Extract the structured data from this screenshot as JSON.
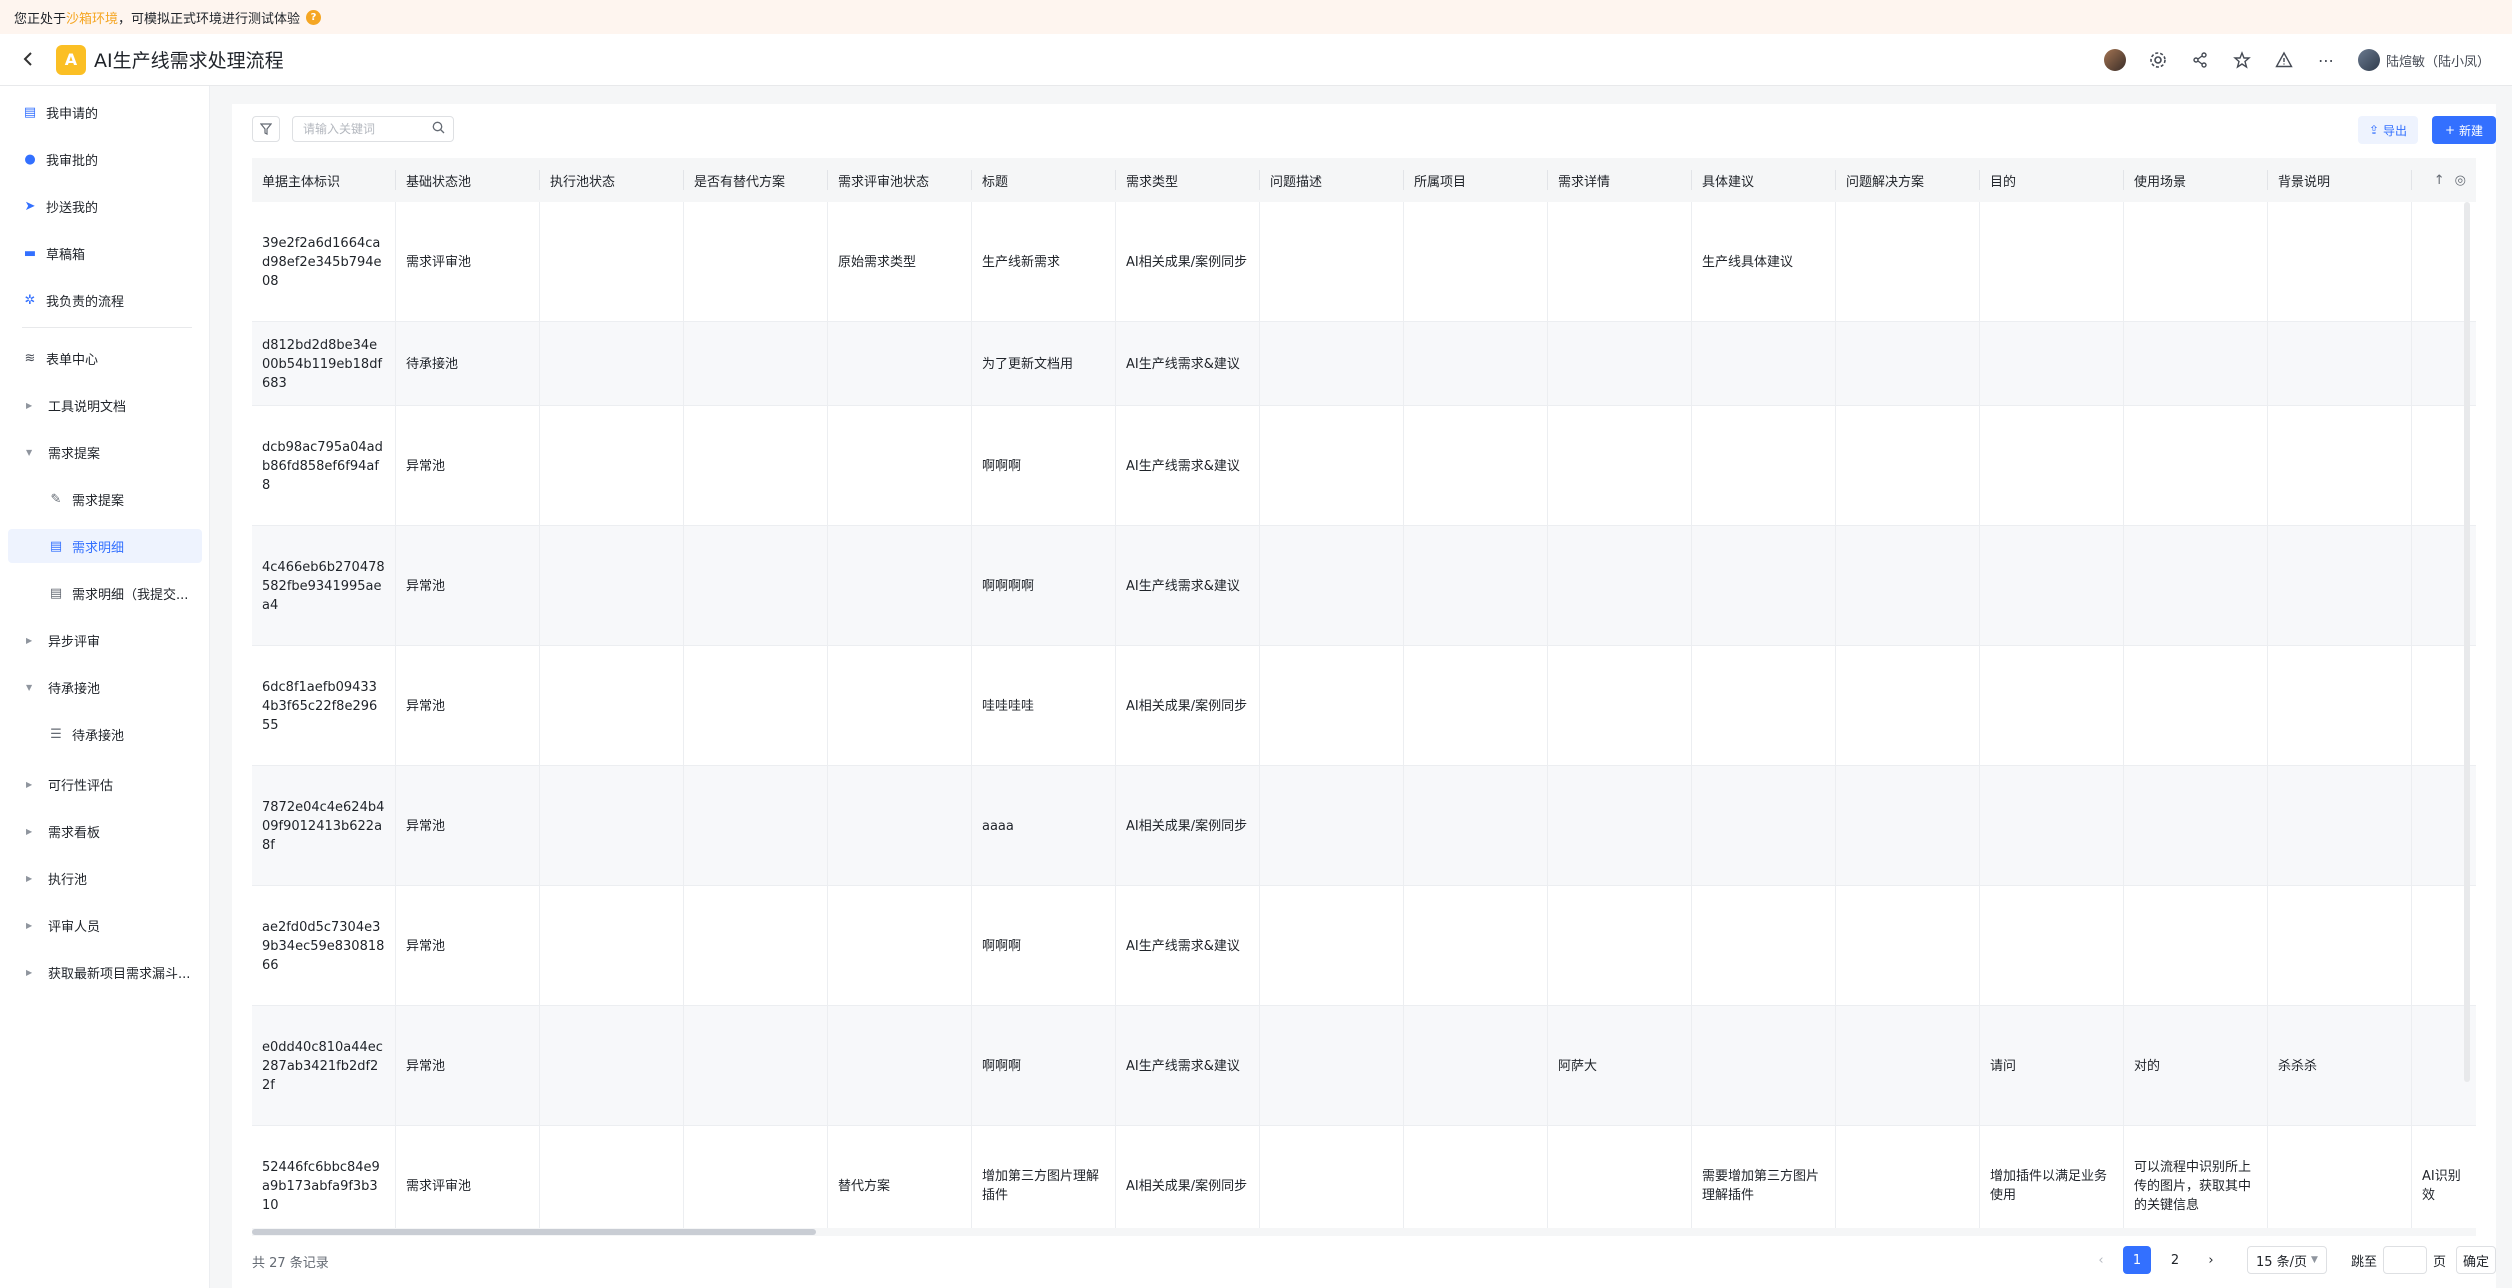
{
  "banner": {
    "prefix": "您正处于",
    "highlight": "沙箱环境",
    "suffix": "，可模拟正式环境进行测试体验"
  },
  "header": {
    "title": "AI生产线需求处理流程",
    "logo_letter": "A",
    "user": "陆煊敏（陆小凤）"
  },
  "sidebar": {
    "items": [
      {
        "label": "我申请的",
        "icon": "document-icon"
      },
      {
        "label": "我审批的",
        "icon": "user-icon"
      },
      {
        "label": "抄送我的",
        "icon": "send-icon"
      },
      {
        "label": "草稿箱",
        "icon": "draft-icon"
      },
      {
        "label": "我负责的流程",
        "icon": "flow-icon"
      },
      {
        "label": "表单中心",
        "icon": "layers-icon"
      },
      {
        "label": "工具说明文档"
      },
      {
        "label": "需求提案"
      },
      {
        "label": "需求提案"
      },
      {
        "label": "需求明细"
      },
      {
        "label": "需求明细（我提交..."
      },
      {
        "label": "异步评审"
      },
      {
        "label": "待承接池"
      },
      {
        "label": "待承接池"
      },
      {
        "label": "可行性评估"
      },
      {
        "label": "需求看板"
      },
      {
        "label": "执行池"
      },
      {
        "label": "评审人员"
      },
      {
        "label": "获取最新项目需求漏斗..."
      }
    ]
  },
  "toolbar": {
    "search_placeholder": "请输入关键词",
    "export_label": "导出",
    "new_label": "新建"
  },
  "table": {
    "columns": [
      "单据主体标识",
      "基础状态池",
      "执行池状态",
      "是否有替代方案",
      "需求评审池状态",
      "标题",
      "需求类型",
      "问题描述",
      "所属项目",
      "需求详情",
      "具体建议",
      "问题解决方案",
      "目的",
      "使用场景",
      "背景说明"
    ],
    "rows": [
      [
        "39e2f2a6d1664cad98ef2e345b794e08",
        "需求评审池",
        "",
        "",
        "原始需求类型",
        "生产线新需求",
        "AI相关成果/案例同步",
        "",
        "",
        "",
        "生产线具体建议",
        "",
        "",
        "",
        "",
        ""
      ],
      [
        "d812bd2d8be34e00b54b119eb18df683",
        "待承接池",
        "",
        "",
        "",
        "为了更新文档用",
        "AI生产线需求&建议",
        "",
        "",
        "",
        "",
        "",
        "",
        "",
        "",
        ""
      ],
      [
        "dcb98ac795a04adb86fd858ef6f94af8",
        "异常池",
        "",
        "",
        "",
        "啊啊啊",
        "AI生产线需求&建议",
        "",
        "",
        "",
        "",
        "",
        "",
        "",
        "",
        ""
      ],
      [
        "4c466eb6b270478582fbe9341995aea4",
        "异常池",
        "",
        "",
        "",
        "啊啊啊啊",
        "AI生产线需求&建议",
        "",
        "",
        "",
        "",
        "",
        "",
        "",
        "",
        ""
      ],
      [
        "6dc8f1aefb094334b3f65c22f8e29655",
        "异常池",
        "",
        "",
        "",
        "哇哇哇哇",
        "AI相关成果/案例同步",
        "",
        "",
        "",
        "",
        "",
        "",
        "",
        "",
        ""
      ],
      [
        "7872e04c4e624b409f9012413b622a8f",
        "异常池",
        "",
        "",
        "",
        "aaaa",
        "AI相关成果/案例同步",
        "",
        "",
        "",
        "",
        "",
        "",
        "",
        "",
        ""
      ],
      [
        "ae2fd0d5c7304e39b34ec59e83081866",
        "异常池",
        "",
        "",
        "",
        "啊啊啊",
        "AI生产线需求&建议",
        "",
        "",
        "",
        "",
        "",
        "",
        "",
        "",
        ""
      ],
      [
        "e0dd40c810a44ec287ab3421fb2df22f",
        "异常池",
        "",
        "",
        "",
        "啊啊啊",
        "AI生产线需求&建议",
        "",
        "",
        "阿萨大",
        "",
        "",
        "请问",
        "对的",
        "杀杀杀",
        ""
      ],
      [
        "52446fc6bbc84e9a9b173abfa9f3b310",
        "需求评审池",
        "",
        "",
        "替代方案",
        "增加第三方图片理解插件",
        "AI相关成果/案例同步",
        "",
        "",
        "",
        "需要增加第三方图片理解插件",
        "",
        "增加插件以满足业务使用",
        "可以流程中识别所上传的图片，获取其中的关键信息",
        "",
        "AI识别效"
      ]
    ]
  },
  "pagination": {
    "total": "共 27 条记录",
    "pages": [
      "1",
      "2"
    ],
    "current": "1",
    "page_size": "15 条/页",
    "jump_label": "跳至",
    "page_unit": "页",
    "confirm": "确定"
  }
}
